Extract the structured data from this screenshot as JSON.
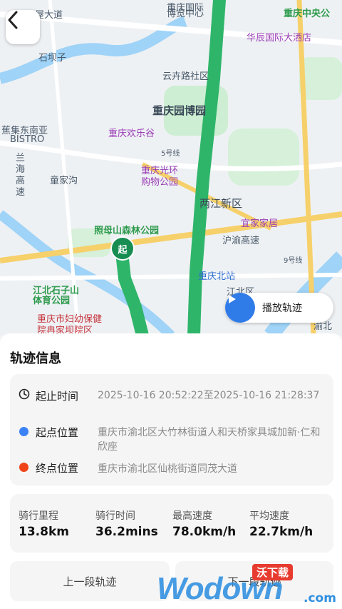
{
  "map": {
    "labels": {
      "l1": "庆屋大道",
      "l2": "重庆国际",
      "l3": "博览中心",
      "l4": "重庆中央公",
      "l5": "华辰国际大酒店",
      "l6": "石坝子",
      "l7": "云卉路社区",
      "l8": "重庆园博园",
      "l9": "蕉集东南亚",
      "l10": "BISTRO",
      "l11": "重庆欢乐谷",
      "l12": "5号线",
      "l13": "兰海高速",
      "l14": "童家沟",
      "l15": "重庆光环",
      "l16": "购物公园",
      "l17": "两江新区",
      "l18": "宜家家居",
      "l19": "照母山森林公园",
      "l20": "沪渝高速",
      "l21": "9号线",
      "l22": "重庆北站",
      "l23": "江北石子山",
      "l24": "体育公园",
      "l25": "江北区",
      "l26": "重庆市妇幼保健",
      "l27": "院冉家坝院区",
      "l28": "渝北"
    },
    "start_marker": "起",
    "play_button": "播放轨迹"
  },
  "sheet": {
    "title": "轨迹信息",
    "start_time_label": "起止时间",
    "start_time_value": "2025-10-16 20:52:22至2025-10-16 21:28:37",
    "start_pos_label": "起点位置",
    "start_pos_value": "重庆市渝北区大竹林街道人和天桥家具城加新·仁和欣座",
    "end_pos_label": "终点位置",
    "end_pos_value": "重庆市渝北区仙桃街道同茂大道",
    "start_dot_color": "#3b82f6",
    "end_dot_color": "#ef4417"
  },
  "stats": {
    "distance_label": "骑行里程",
    "distance_value": "13.8km",
    "duration_label": "骑行时间",
    "duration_value": "36.2mins",
    "max_speed_label": "最高速度",
    "max_speed_value": "78.0km/h",
    "avg_speed_label": "平均速度",
    "avg_speed_value": "22.7km/h"
  },
  "buttons": {
    "prev": "上一段轨迹",
    "next": "下一段轨迹"
  },
  "watermark": {
    "logo": "Wodown",
    "badge": "沃下载",
    "suffix": ".com"
  },
  "colors": {
    "route": "#2fb56a",
    "accent": "#2f7be8"
  }
}
